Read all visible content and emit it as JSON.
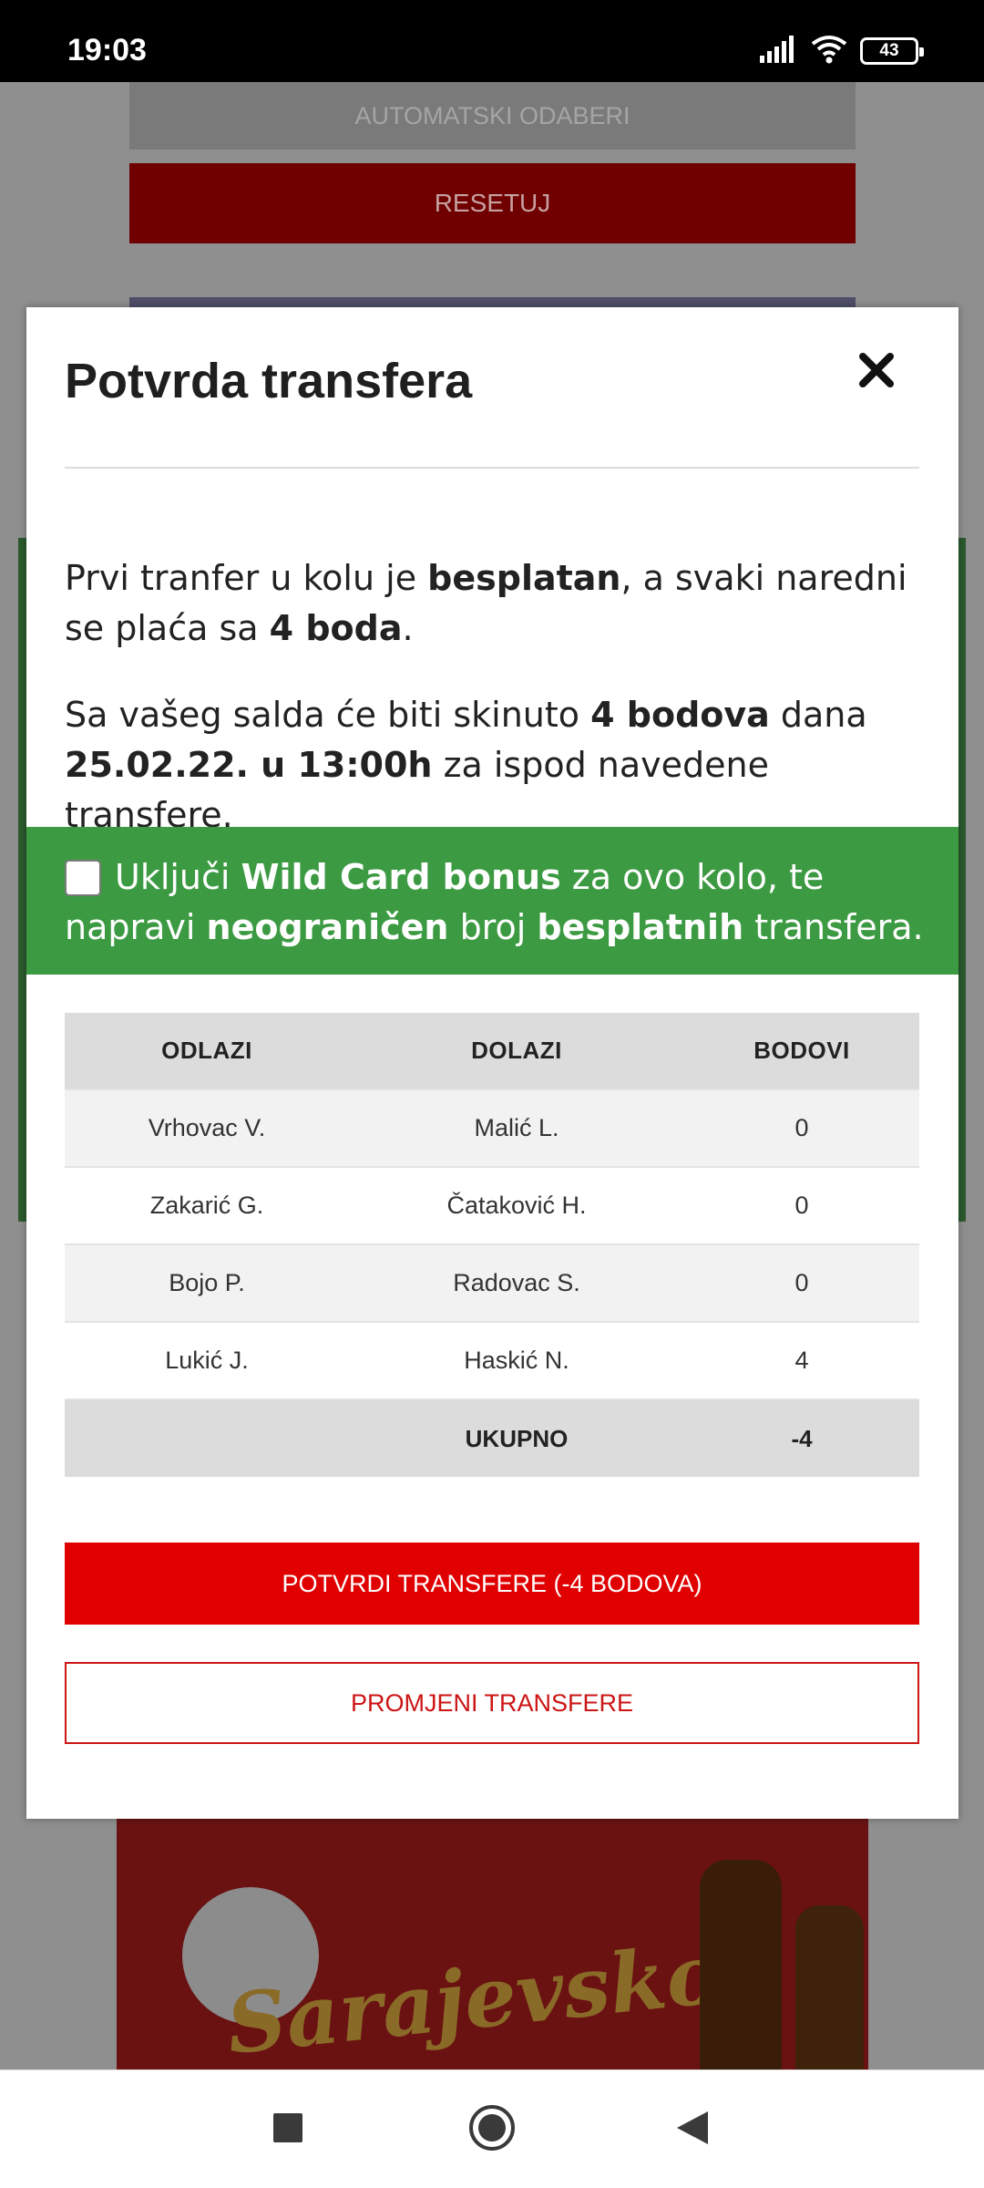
{
  "status_bar": {
    "time": "19:03",
    "battery": "43"
  },
  "background": {
    "auto_select_label": "AUTOMATSKI ODABERI",
    "reset_label": "RESETUJ"
  },
  "modal": {
    "title": "Potvrda transfera",
    "info1": {
      "t1": "Prvi tranfer u kolu je ",
      "b1": "besplatan",
      "t2": ", a svaki naredni se plaća sa ",
      "b2": "4 boda",
      "t3": "."
    },
    "info2": {
      "t1": "Sa vašeg salda će biti skinuto ",
      "b1": "4 bodova",
      "t2": " dana ",
      "b2": "25.02.22. u 13:00h",
      "t3": " za ispod navedene transfere."
    },
    "wildcard": {
      "t1": "Uključi ",
      "b1": "Wild Card bonus",
      "t2": " za ovo kolo, te napravi ",
      "b2": "neograničen",
      "t3": " broj ",
      "b3": "besplatnih",
      "t4": " transfera.",
      "checked": false
    },
    "table": {
      "headers": [
        "ODLAZI",
        "DOLAZI",
        "BODOVI"
      ],
      "rows": [
        [
          "Vrhovac V.",
          "Malić L.",
          "0"
        ],
        [
          "Zakarić G.",
          "Čataković H.",
          "0"
        ],
        [
          "Bojo P.",
          "Radovac S.",
          "0"
        ],
        [
          "Lukić J.",
          "Haskić N.",
          "4"
        ]
      ],
      "total_label": "UKUPNO",
      "total_value": "-4"
    },
    "confirm_label": "POTVRDI TRANSFERE (-4 BODOVA)",
    "change_label": "PROMJENI TRANSFERE"
  },
  "icons": {
    "close": "close-icon",
    "signal": "signal-icon",
    "wifi": "wifi-icon",
    "battery": "battery-icon",
    "recents": "recents-icon",
    "home": "home-icon",
    "back": "back-icon"
  },
  "colors": {
    "primary_red": "#e00000",
    "outline_red": "#cc1515",
    "wildcard_green": "#3c9a42",
    "table_header": "#dcdcdc"
  }
}
